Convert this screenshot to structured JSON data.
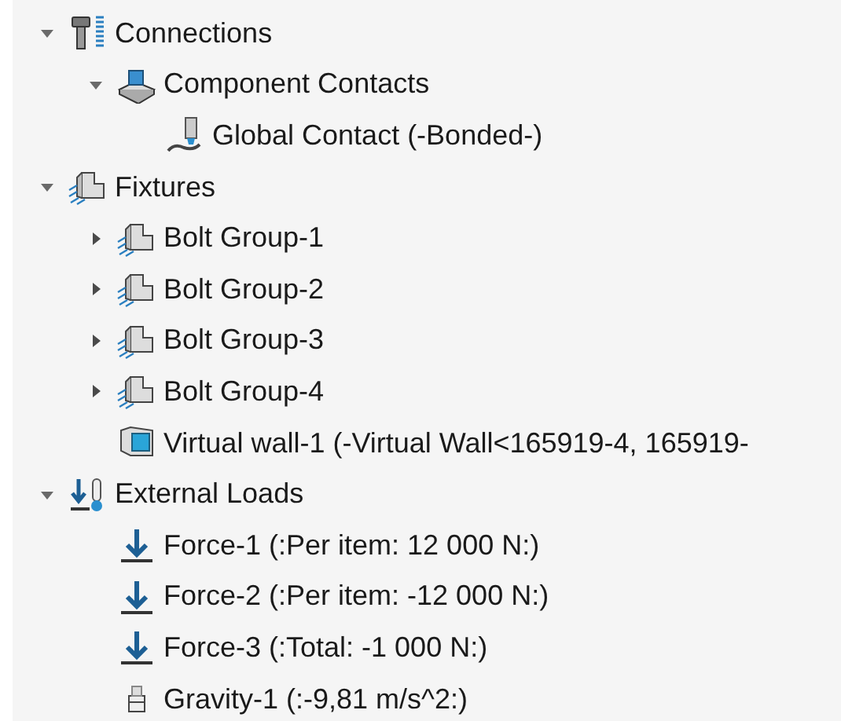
{
  "tree": [
    {
      "label": "Connections",
      "kind": "connections",
      "expanded": true,
      "children": [
        {
          "label": "Component Contacts",
          "kind": "contacts",
          "expanded": true,
          "children": [
            {
              "label": "Global Contact (-Bonded-)",
              "kind": "contact"
            }
          ]
        }
      ]
    },
    {
      "label": "Fixtures",
      "kind": "fixture",
      "expanded": true,
      "children": [
        {
          "label": "Bolt Group-1",
          "kind": "fixture",
          "expanded": false
        },
        {
          "label": "Bolt Group-2",
          "kind": "fixture",
          "expanded": false
        },
        {
          "label": "Bolt Group-3",
          "kind": "fixture",
          "expanded": false
        },
        {
          "label": "Bolt Group-4",
          "kind": "fixture",
          "expanded": false
        },
        {
          "label": "Virtual wall-1 (-Virtual Wall<165919-4, 165919-",
          "kind": "wall"
        }
      ]
    },
    {
      "label": "External Loads",
      "kind": "loads",
      "expanded": true,
      "children": [
        {
          "label": "Force-1 (:Per item: 12 000 N:)",
          "kind": "force"
        },
        {
          "label": "Force-2 (:Per item: -12 000 N:)",
          "kind": "force"
        },
        {
          "label": "Force-3 (:Total: -1 000 N:)",
          "kind": "force"
        },
        {
          "label": "Gravity-1 (:-9,81 m/s^2:)",
          "kind": "gravity"
        }
      ]
    }
  ]
}
